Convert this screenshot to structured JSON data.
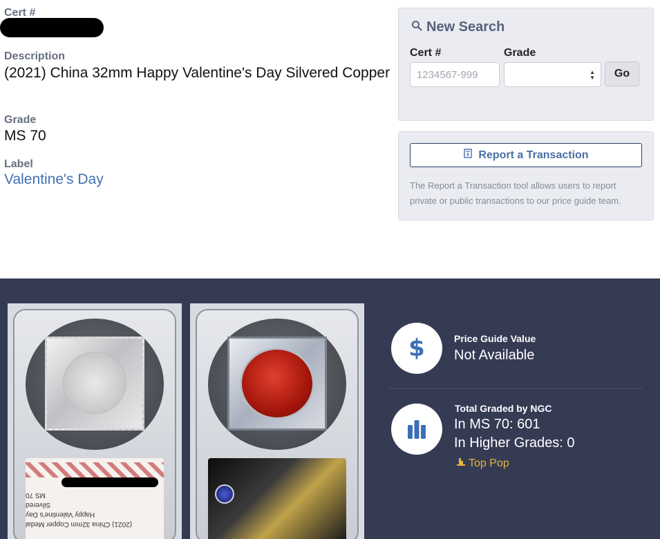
{
  "details": {
    "cert_label": "Cert #",
    "description_label": "Description",
    "description_value": "(2021) China 32mm Happy Valentine's Day Silvered Copper",
    "grade_label": "Grade",
    "grade_value": "MS 70",
    "label_label": "Label",
    "label_value": "Valentine's Day"
  },
  "search": {
    "title": "New Search",
    "cert_label": "Cert #",
    "cert_placeholder": "1234567-999",
    "grade_label": "Grade",
    "grade_value": "",
    "go_label": "Go"
  },
  "report": {
    "button_label": "Report a Transaction",
    "description": "The Report a Transaction tool allows users to report private or public transactions to our price guide team."
  },
  "stats": {
    "price_heading": "Price Guide Value",
    "price_value": "Not Available",
    "graded_heading": "Total Graded by NGC",
    "in_grade": "In MS 70: 601",
    "higher_grades": "In Higher Grades: 0",
    "top_pop": "Top Pop"
  },
  "slab_label_lines": [
    "(2021) China 32mm Copper Medal",
    "Happy Valentine's Day",
    "Silvered",
    "MS 70"
  ],
  "colors": {
    "band": "#363b54",
    "link": "#3f72b5",
    "accent_gold": "#e8b53c",
    "icon_blue": "#3d6fb6"
  }
}
